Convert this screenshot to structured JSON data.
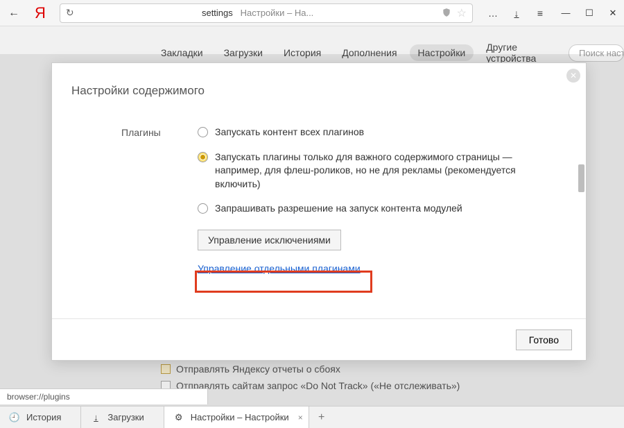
{
  "chrome": {
    "address_prefix": "settings",
    "address_title": "Настройки – На...",
    "downloads_icon": "↓",
    "menu_icon": "≡",
    "more_dots": "…",
    "min": "—",
    "max": "☐",
    "close": "✕"
  },
  "tabs": {
    "items": [
      "Закладки",
      "Загрузки",
      "История",
      "Дополнения",
      "Настройки",
      "Другие устройства"
    ],
    "search_placeholder": "Поиск наст"
  },
  "modal": {
    "title": "Настройки содержимого",
    "section_label": "Плагины",
    "radios": {
      "r1": "Запускать контент всех плагинов",
      "r2": "Запускать плагины только для важного содержимого страницы — например, для флеш-роликов, но не для рекламы (рекомендуется включить)",
      "r3": "Запрашивать разрешение на запуск контента модулей"
    },
    "exceptions_btn": "Управление исключениями",
    "plugins_link": "Управление отдельными плагинами",
    "done_btn": "Готово"
  },
  "bg": {
    "row1": "Отправлять Яндексу отчеты о сбоях",
    "row2": "Отправлять сайтам запрос «Do Not Track» («Не отслеживать»)"
  },
  "status_bar": "browser://plugins",
  "bottom_tabs": {
    "history": "История",
    "downloads": "Загрузки",
    "settings": "Настройки – Настройки"
  }
}
